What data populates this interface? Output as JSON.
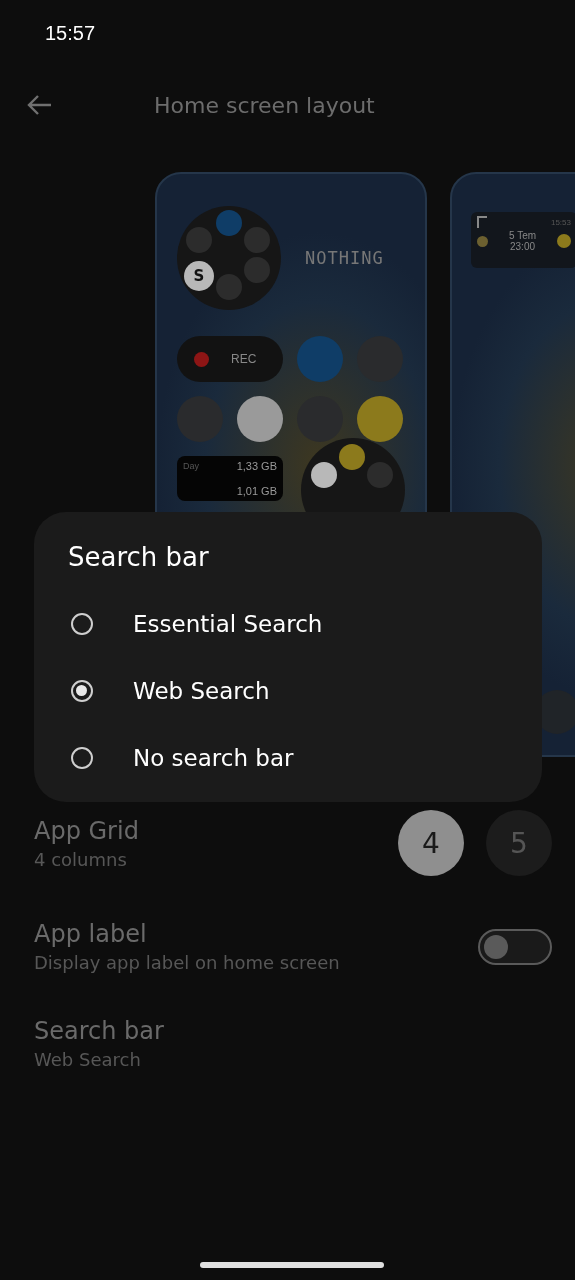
{
  "status_bar": {
    "time": "15:57"
  },
  "header": {
    "title": "Home screen layout"
  },
  "preview_1": {
    "app_letter": "S",
    "brand_text": "NOTHING",
    "record_label": "REC",
    "data_widget": {
      "label": "Day",
      "day_usage": "1,33 GB",
      "total_usage": "1,01 GB"
    }
  },
  "preview_2": {
    "time": "15:53",
    "match_date": "5 Tem",
    "match_time": "23:00"
  },
  "settings": [
    {
      "kind": "grid",
      "title": "App Grid",
      "subtitle": "4 columns",
      "options": [
        {
          "label": "4",
          "selected": true
        },
        {
          "label": "5",
          "selected": false
        }
      ]
    },
    {
      "kind": "toggle",
      "title": "App label",
      "subtitle": "Display app label on home screen",
      "on": false
    },
    {
      "kind": "plain",
      "title": "Search bar",
      "subtitle": "Web Search"
    }
  ],
  "dialog": {
    "title": "Search bar",
    "options": [
      {
        "label": "Essential Search",
        "selected": false
      },
      {
        "label": "Web Search",
        "selected": true
      },
      {
        "label": "No search bar",
        "selected": false
      }
    ]
  }
}
